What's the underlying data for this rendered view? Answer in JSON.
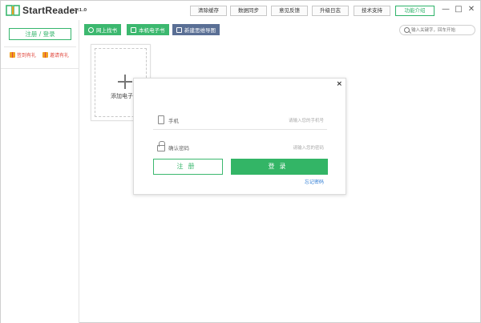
{
  "app": {
    "name": "StartReader",
    "version": "v3.1.0"
  },
  "titlebar": {
    "buttons": [
      {
        "label": "清除缓存"
      },
      {
        "label": "数据同步"
      },
      {
        "label": "意见反馈"
      },
      {
        "label": "升级日志"
      },
      {
        "label": "技术支持"
      },
      {
        "label": "功能介绍"
      }
    ],
    "controls": {
      "minimize": "—",
      "maximize": "□",
      "close": "✕"
    }
  },
  "sidebar": {
    "register_login": "注册 / 登录",
    "gifts": [
      {
        "label": "签到有礼"
      },
      {
        "label": "邀请有礼"
      }
    ]
  },
  "toolbar": {
    "buttons": [
      {
        "label": "网上找书"
      },
      {
        "label": "本机电子书"
      },
      {
        "label": "新建思维导图"
      }
    ],
    "search_placeholder": "输入关键字，回车开始"
  },
  "library": {
    "add_book_label": "添加电子书"
  },
  "modal": {
    "close": "×",
    "phone_label": "手机",
    "phone_placeholder": "请输入您的手机号",
    "password_label": "确认密码",
    "password_placeholder": "请输入您的密码",
    "register_button": "注册",
    "login_button": "登录",
    "forgot_password": "忘记密码"
  },
  "colors": {
    "accent": "#33b566",
    "toolbar_blue": "#5a6f95",
    "link": "#2d7bd4",
    "gift": "#e0463c"
  }
}
